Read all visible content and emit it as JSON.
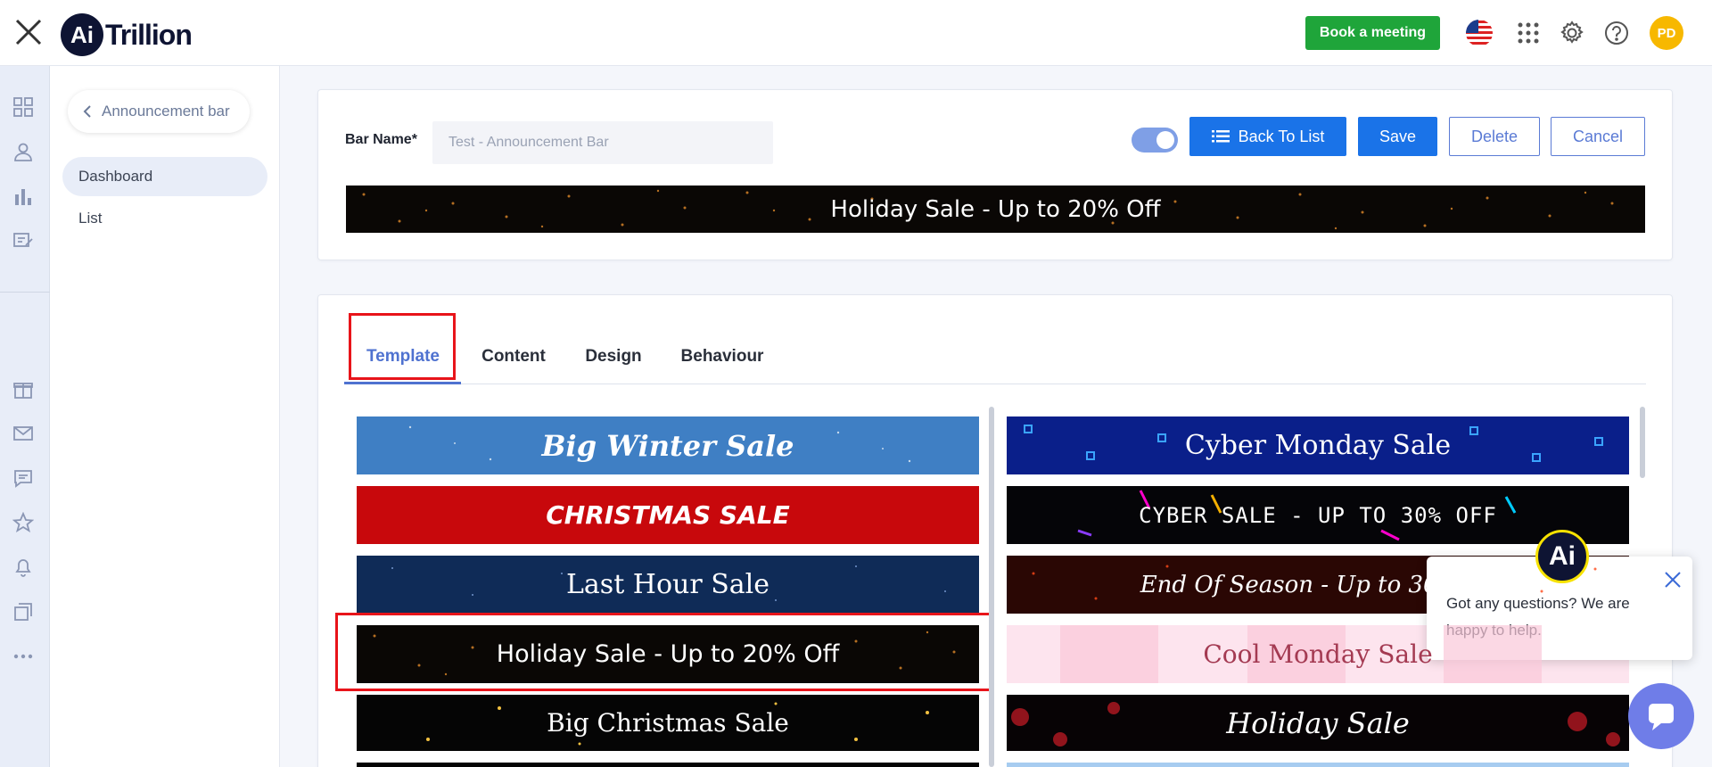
{
  "header": {
    "logo_mark": "Ai",
    "logo_text": "Trillion",
    "book_meeting_label": "Book a meeting",
    "avatar_initials": "PD"
  },
  "subnav": {
    "breadcrumb_label": "Announcement bar",
    "items": [
      {
        "label": "Dashboard",
        "active": true
      },
      {
        "label": "List",
        "active": false
      }
    ]
  },
  "form": {
    "bar_name_label": "Bar Name*",
    "bar_name_value": "Test - Announcement Bar",
    "toggle_on": true,
    "back_to_list_label": "Back To List",
    "save_label": "Save",
    "delete_label": "Delete",
    "cancel_label": "Cancel",
    "preview_text": "Holiday Sale - Up to 20% Off"
  },
  "tabs": [
    {
      "label": "Template",
      "active": true
    },
    {
      "label": "Content",
      "active": false
    },
    {
      "label": "Design",
      "active": false
    },
    {
      "label": "Behaviour",
      "active": false
    }
  ],
  "templates_left": [
    {
      "text": "Big Winter Sale",
      "bg": "#3f7fc4",
      "selected": false
    },
    {
      "text": "CHRISTMAS SALE",
      "bg": "#c8080c",
      "selected": false
    },
    {
      "text": "Last Hour Sale",
      "bg": "#0f2b57",
      "selected": false
    },
    {
      "text": "Holiday Sale - Up to 20% Off",
      "bg": "#0a0705",
      "selected": true
    },
    {
      "text": "Big Christmas Sale",
      "bg": "#050505",
      "selected": false
    }
  ],
  "templates_right": [
    {
      "text": "Cyber Monday Sale",
      "bg": "#0a1f8a"
    },
    {
      "text": "cyber sale - up to 30% off",
      "bg": "#050508"
    },
    {
      "text": "End Of Season - Up to 30%",
      "bg": "#2a0704"
    },
    {
      "text": "Cool Monday Sale",
      "bg": "#fde4ee"
    },
    {
      "text": "Holiday Sale",
      "bg": "#070305"
    }
  ],
  "chat": {
    "badge": "Ai",
    "message": "Got any questions? We are happy to help."
  },
  "colors": {
    "primary": "#1a73e8",
    "accent": "#4f72d0",
    "green": "#1fa53a",
    "highlight": "#e8141a"
  }
}
